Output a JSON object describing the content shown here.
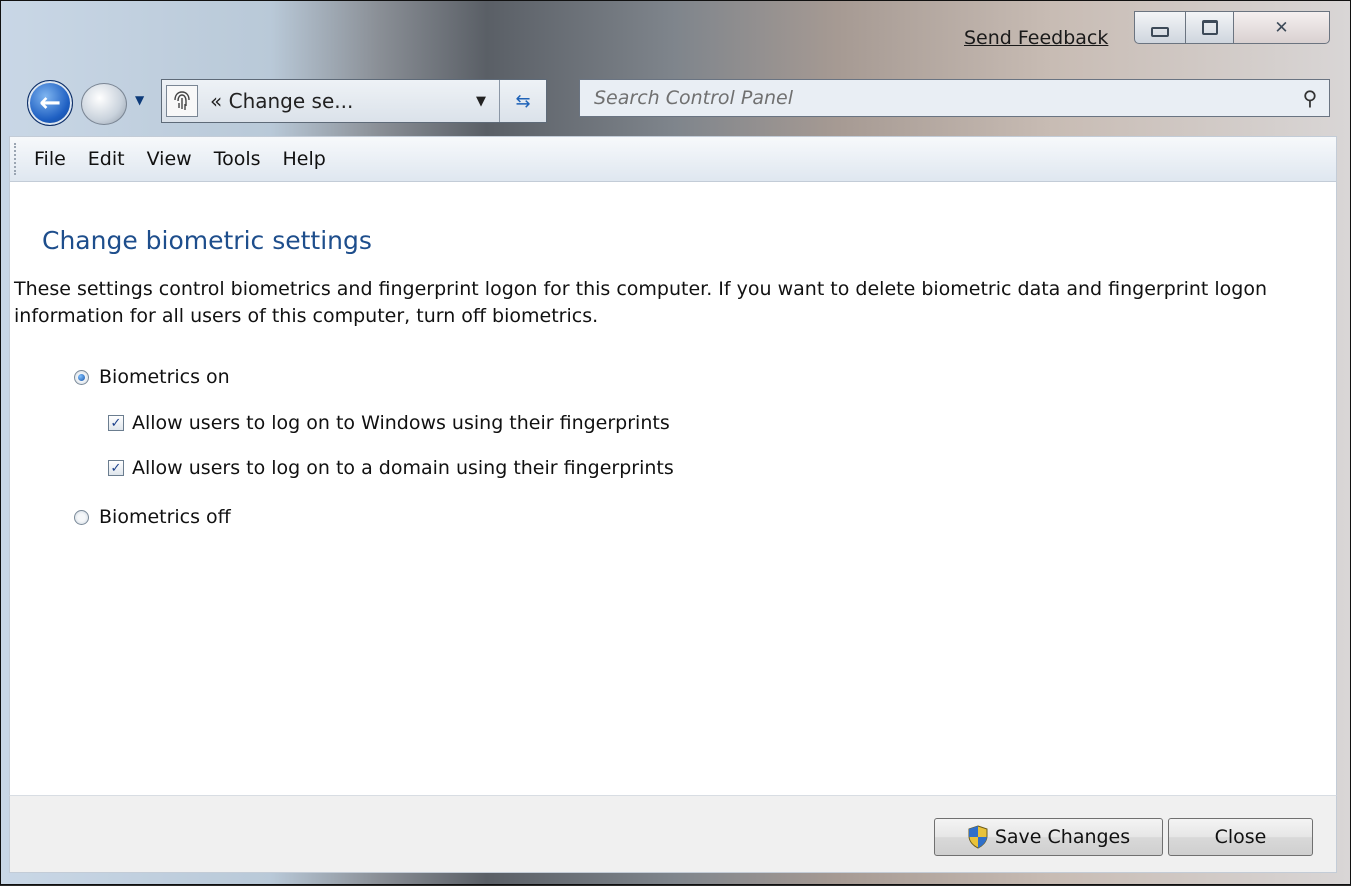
{
  "caption": {
    "feedback_link": "Send Feedback",
    "minimize_icon": "minimize-icon",
    "maximize_icon": "maximize-icon",
    "close_icon": "close-icon"
  },
  "nav": {
    "back_icon": "back-arrow-icon",
    "forward_icon": "forward-arrow-icon",
    "address": {
      "icon": "fingerprint-icon",
      "chevrons": "«",
      "text": "Change se...",
      "dropdown_icon": "chevron-down-icon",
      "refresh_icon": "refresh-icon"
    },
    "search": {
      "placeholder": "Search Control Panel",
      "icon": "search-icon"
    }
  },
  "menu": {
    "items": [
      "File",
      "Edit",
      "View",
      "Tools",
      "Help"
    ]
  },
  "main": {
    "title": "Change biometric settings",
    "description": "These settings control biometrics and fingerprint logon for this computer. If you want to delete biometric data and fingerprint logon information for all users of this computer, turn off biometrics.",
    "radio_on": {
      "label": "Biometrics on",
      "checked": true
    },
    "check_windows": {
      "label": "Allow users to log on to Windows using their fingerprints",
      "checked": true
    },
    "check_domain": {
      "label": "Allow users to log on to a domain using their fingerprints",
      "checked": true
    },
    "radio_off": {
      "label": "Biometrics off",
      "checked": false
    }
  },
  "footer": {
    "save_label": "Save Changes",
    "save_icon": "uac-shield-icon",
    "close_label": "Close"
  },
  "colors": {
    "title_blue": "#1e4e8c",
    "content_bg": "#ffffff",
    "footer_bg": "#f0f0f0"
  }
}
